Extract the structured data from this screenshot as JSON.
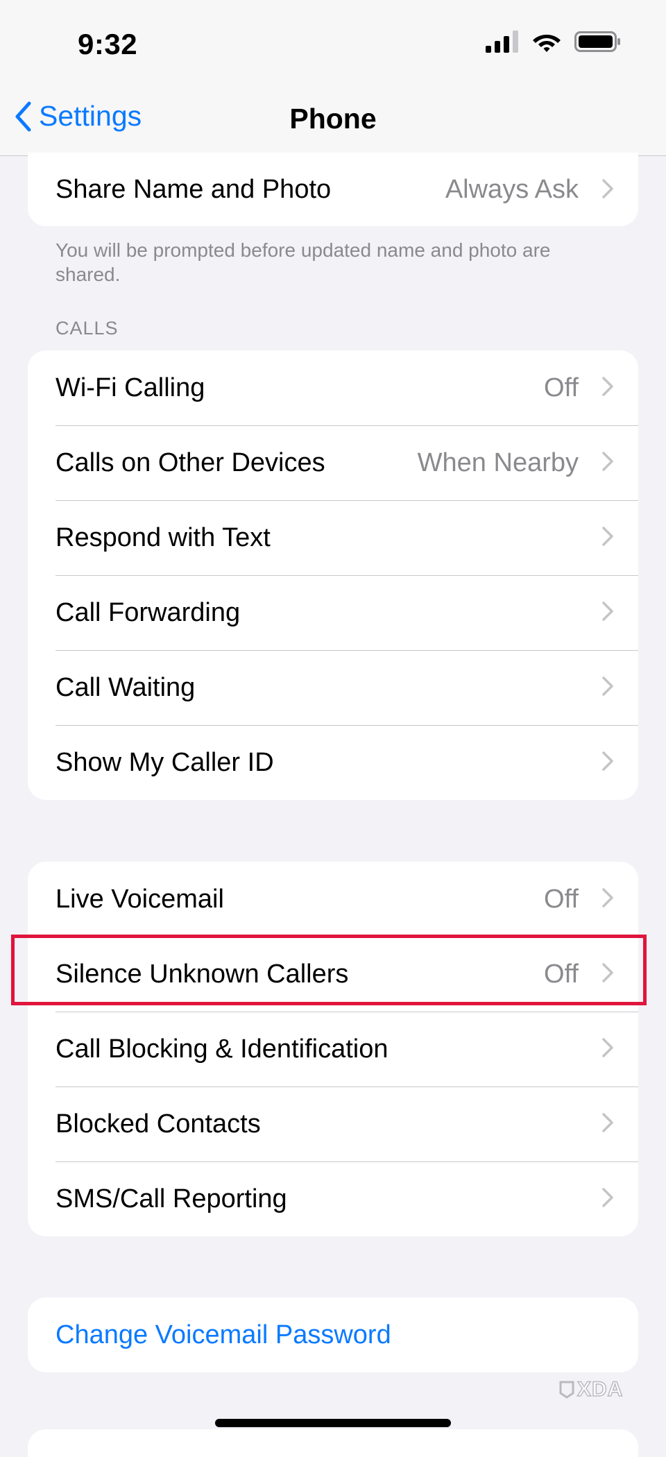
{
  "status_bar": {
    "time": "9:32",
    "icons": [
      "cellular-signal-icon",
      "wifi-icon",
      "battery-icon"
    ]
  },
  "nav": {
    "back_label": "Settings",
    "title": "Phone"
  },
  "share_section": {
    "row": {
      "label": "Share Name and Photo",
      "value": "Always Ask"
    },
    "footnote": "You will be prompted before updated name and photo are shared."
  },
  "calls_section": {
    "header": "CALLS",
    "rows": [
      {
        "label": "Wi-Fi Calling",
        "value": "Off"
      },
      {
        "label": "Calls on Other Devices",
        "value": "When Nearby"
      },
      {
        "label": "Respond with Text",
        "value": ""
      },
      {
        "label": "Call Forwarding",
        "value": ""
      },
      {
        "label": "Call Waiting",
        "value": ""
      },
      {
        "label": "Show My Caller ID",
        "value": ""
      }
    ]
  },
  "voicemail_section": {
    "rows": [
      {
        "label": "Live Voicemail",
        "value": "Off"
      },
      {
        "label": "Silence Unknown Callers",
        "value": "Off"
      },
      {
        "label": "Call Blocking & Identification",
        "value": ""
      },
      {
        "label": "Blocked Contacts",
        "value": ""
      },
      {
        "label": "SMS/Call Reporting",
        "value": ""
      }
    ]
  },
  "password_section": {
    "link_label": "Change Voicemail Password"
  },
  "watermark": {
    "text": "XDA"
  },
  "colors": {
    "accent": "#0a7aff",
    "background": "#f2f2f7",
    "secondary_text": "#8a8a8e",
    "highlight": "#e0143c"
  }
}
